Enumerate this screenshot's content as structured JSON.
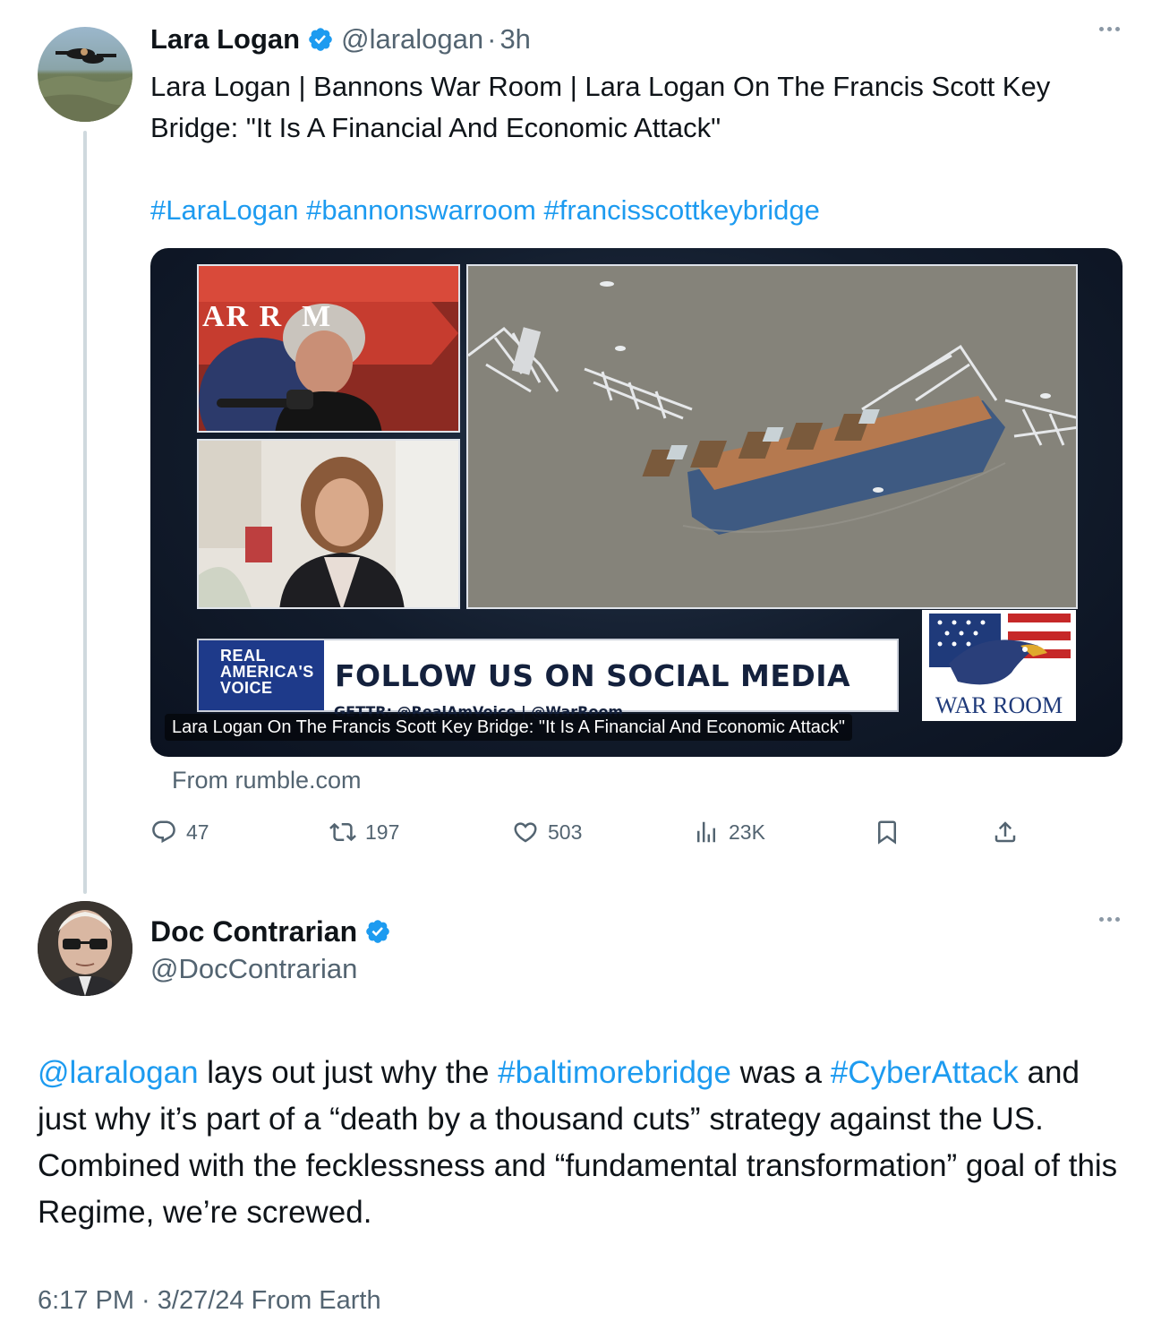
{
  "quoted_tweet": {
    "author_name": "Lara Logan",
    "handle": "@laralogan",
    "separator": "·",
    "time_ago": "3h",
    "text": "Lara Logan | Bannons War Room | Lara Logan On The Francis Scott Key Bridge: \"It Is A Financial And Economic Attack\"",
    "hashtags": "#LaraLogan #bannonswarroom #francisscottkeybridge",
    "media": {
      "banner_brand_line1": "REAL",
      "banner_brand_line2": "AMERICA'S",
      "banner_brand_line3": "VOICE",
      "banner_headline": "FOLLOW US ON SOCIAL MEDIA",
      "banner_subline": "GETTR: @RealAmVoice  |  @WarRoom",
      "logo_text": "WAR ROOM",
      "panel_host_text": "AR R  M",
      "caption": "Lara Logan On The Francis Scott Key Bridge: \"It Is A Financial And Economic Attack\""
    },
    "source": "From rumble.com",
    "actions": {
      "replies": "47",
      "reposts": "197",
      "likes": "503",
      "views": "23K"
    }
  },
  "main_tweet": {
    "author_name": "Doc Contrarian",
    "handle": "@DocContrarian",
    "text_mention": "@laralogan",
    "text_part1": " lays out just why the ",
    "text_hashtag1": "#baltimorebridge",
    "text_part2": " was a ",
    "text_hashtag2": "#CyberAttack",
    "text_part3": " and just why it’s part of a “death by a thousand cuts” strategy against the US. Combined with the fecklessness and “fundamental transformation” goal of this Regime, we’re screwed.",
    "timestamp": "6:17 PM · 3/27/24 From Earth"
  },
  "colors": {
    "link": "#1d9bf0",
    "secondary_text": "#536471",
    "verified_badge": "#1d9bf0"
  }
}
